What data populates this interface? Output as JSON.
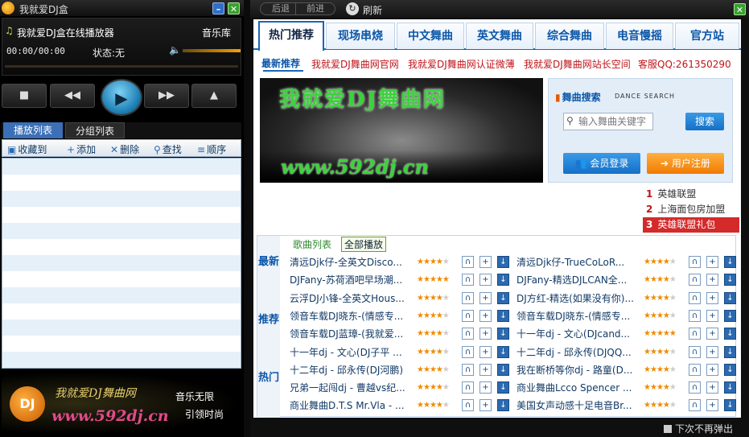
{
  "player": {
    "title": "我就爱DJ盒",
    "now_playing": "我就爱DJ盒在线播放器",
    "music_lib": "音乐库",
    "time": "00:00/00:00",
    "status": "状态:无",
    "tabs": [
      "播放列表",
      "分组列表"
    ],
    "toolbar": [
      "收藏到",
      "添加",
      "删除",
      "查找",
      "顺序"
    ],
    "banner": {
      "logo_text": "DJ",
      "name": "我就爱DJ舞曲网",
      "url": "www.592dj.cn",
      "slogan1": "音乐无限",
      "slogan2": "引领时尚"
    }
  },
  "browser": {
    "back": "后退",
    "forward": "前进",
    "refresh": "刷新",
    "tabs": [
      "热门推荐",
      "现场串烧",
      "中文舞曲",
      "英文舞曲",
      "综合舞曲",
      "电音慢摇",
      "官方站"
    ],
    "subnav_title": "最新推荐",
    "subnav_links": [
      "我就爱DJ舞曲网官网",
      "我就爱DJ舞曲网认证微薄",
      "我就爱DJ舞曲网站长空间",
      "客服QQ:261350290"
    ],
    "hero": {
      "title": "我就爱DJ舞曲网",
      "url": "www.592dj.cn"
    },
    "search": {
      "title": "舞曲搜索",
      "subtitle": "DANCE SEARCH",
      "placeholder": "输入舞曲关键字",
      "button": "搜索",
      "login": "会员登录",
      "register": "用户注册"
    },
    "rank": [
      {
        "n": "1",
        "name": "英雄联盟"
      },
      {
        "n": "2",
        "name": "上海面包房加盟"
      },
      {
        "n": "3",
        "name": "英雄联盟礼包"
      }
    ],
    "songs_header": "歌曲列表",
    "all_play": "全部播放",
    "side_tabs": [
      "最新",
      "推荐",
      "热门"
    ],
    "songs_left": [
      {
        "name": "清远Djk仔-全英文Disco...",
        "stars": 4
      },
      {
        "name": "DJFany-苏荷酒吧早场潮...",
        "stars": 5
      },
      {
        "name": "云浮DJ小锋-全英文Hous...",
        "stars": 4
      },
      {
        "name": "领音车载DJ晓东-(情感专...",
        "stars": 4
      },
      {
        "name": "领音车载DJ蓝璋-(我就爱...",
        "stars": 4
      },
      {
        "name": "十一年dj - 文心(DJ子平 ...",
        "stars": 4
      },
      {
        "name": "十二年dj - 邱永传(DJ河鹏)",
        "stars": 4
      },
      {
        "name": "兄弟一起闯dj - 曹越vs纪...",
        "stars": 4
      },
      {
        "name": "商业舞曲D.T.S Mr.Vla - ...",
        "stars": 4
      }
    ],
    "songs_right": [
      {
        "name": "清远Djk仔-TrueCoLoR...",
        "stars": 4
      },
      {
        "name": "DJFany-精选DJLCAN全...",
        "stars": 4
      },
      {
        "name": "DJ方红-精选(如果没有你)...",
        "stars": 4
      },
      {
        "name": "领音车载DJ晓东-(情感专...",
        "stars": 4
      },
      {
        "name": "十一年dj - 文心(DJcand...",
        "stars": 5
      },
      {
        "name": "十二年dj - 邱永传(DJQQ...",
        "stars": 4
      },
      {
        "name": "我在断桥等你dj - 路童(D...",
        "stars": 4
      },
      {
        "name": "商业舞曲Lcco Spencer ...",
        "stars": 4
      },
      {
        "name": "美国女声动感十足电音Br...",
        "stars": 4
      }
    ],
    "no_more_popup": "下次不再弹出"
  }
}
